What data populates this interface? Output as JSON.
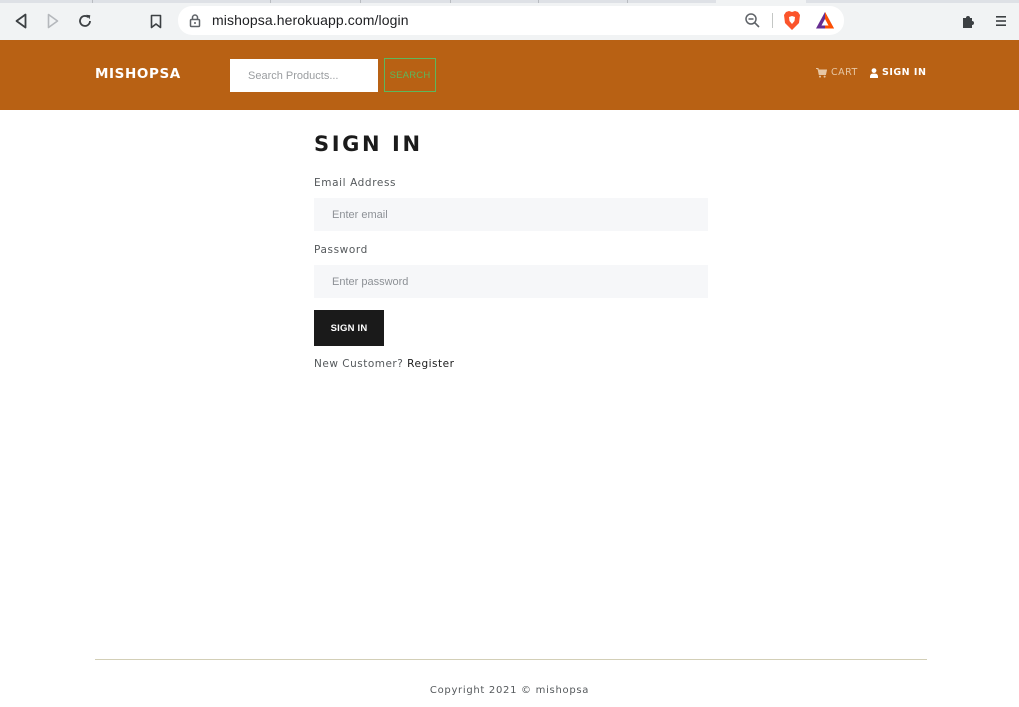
{
  "browser": {
    "url": "mishopsa.herokuapp.com/login",
    "icons": [
      "back-icon",
      "forward-icon",
      "reload-icon",
      "bookmark-icon",
      "lock-icon",
      "zoom-out-icon",
      "brave-shields-icon",
      "brave-rewards-icon",
      "extensions-icon",
      "menu-icon"
    ]
  },
  "navbar": {
    "brand": "MISHOPSA",
    "search_placeholder": "Search Products...",
    "search_button": "SEARCH",
    "cart_label": "CART",
    "signin_label": "SIGN IN",
    "colors": {
      "background": "#b86114",
      "search_accent": "#5cb85c"
    }
  },
  "form": {
    "title": "SIGN IN",
    "email_label": "Email Address",
    "email_placeholder": "Enter email",
    "email_value": "",
    "password_label": "Password",
    "password_placeholder": "Enter password",
    "password_value": "",
    "submit_label": "SIGN IN",
    "new_customer_text": "New Customer?",
    "register_link": "Register"
  },
  "footer": {
    "copyright": "Copyright 2021 © mishopsa"
  }
}
